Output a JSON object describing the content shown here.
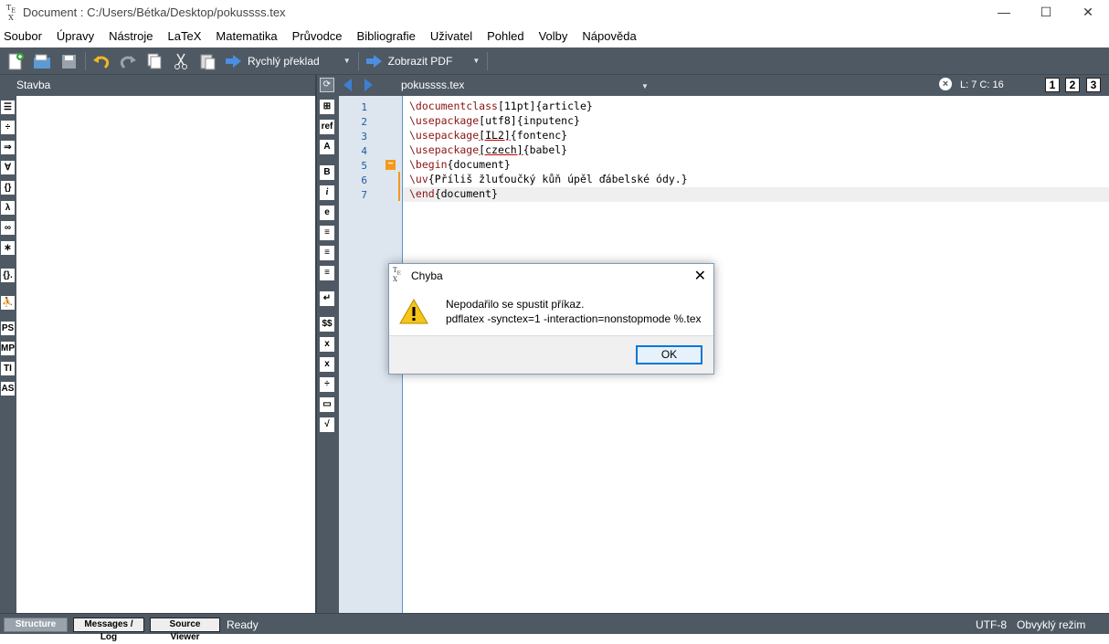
{
  "window": {
    "title": "Document : C:/Users/Bétka/Desktop/pokussss.tex",
    "icon": "tex-icon",
    "controls": {
      "minimize": "—",
      "maximize": "☐",
      "close": "✕"
    }
  },
  "menu": [
    "Soubor",
    "Úpravy",
    "Nástroje",
    "LaTeX",
    "Matematika",
    "Průvodce",
    "Bibliografie",
    "Uživatel",
    "Pohled",
    "Volby",
    "Nápověda"
  ],
  "toolbar": {
    "quick_build": "Rychlý překlad",
    "view_pdf": "Zobrazit PDF"
  },
  "structure": {
    "title": "Stavba"
  },
  "editor_bar": {
    "filename": "pokussss.tex",
    "position": "L: 7 C: 16",
    "views": [
      "1",
      "2",
      "3"
    ]
  },
  "left_icons": [
    "☰",
    "÷",
    "⇒",
    "∀",
    "{}",
    "λ",
    "∞",
    "∗",
    "{}.",
    "⛹",
    "PS",
    "MP",
    "TI",
    "AS"
  ],
  "mid_icons": [
    "⊞",
    "ref",
    "A",
    "B",
    "i",
    "e",
    "≡",
    "≡",
    "≡",
    "↵",
    "$$",
    "x",
    "x",
    "÷",
    "▭",
    "√"
  ],
  "editor": {
    "line_numbers": [
      "1",
      "2",
      "3",
      "4",
      "5",
      "6",
      "7"
    ],
    "lines": [
      {
        "cmd": "\\documentclass",
        "opt": "[11pt]",
        "arg": "{article}"
      },
      {
        "cmd": "\\usepackage",
        "opt": "[utf8]",
        "arg": "{inputenc}"
      },
      {
        "cmd": "\\usepackage",
        "opt": "[IL2]",
        "arg": "{fontenc}"
      },
      {
        "cmd": "\\usepackage",
        "opt": "[czech]",
        "arg": "{babel}"
      },
      {
        "cmd": "\\begin",
        "opt": "",
        "arg": "{document}"
      },
      {
        "cmd": "\\uv",
        "opt": "",
        "arg": "{Příliš žluťoučký kůň úpěl ďábelské ódy.}"
      },
      {
        "cmd": "\\end",
        "opt": "",
        "arg": "{document}"
      }
    ],
    "fold_marker": "−"
  },
  "dialog": {
    "title": "Chyba",
    "message_line1": "Nepodařilo se spustit příkaz.",
    "message_line2": "pdflatex -synctex=1 -interaction=nonstopmode %.tex",
    "ok_label": "OK",
    "close": "✕"
  },
  "statusbar": {
    "tabs": [
      "Structure",
      "Messages / Log",
      "Source Viewer"
    ],
    "status": "Ready",
    "encoding": "UTF-8",
    "mode": "Obvyklý režim"
  },
  "colors": {
    "panel": "#4f5963",
    "gutter": "#dde5ee",
    "keyword": "#8b1414",
    "line_number": "#1c5aa6",
    "fold": "#f39a1e",
    "accent": "#0078d7"
  }
}
